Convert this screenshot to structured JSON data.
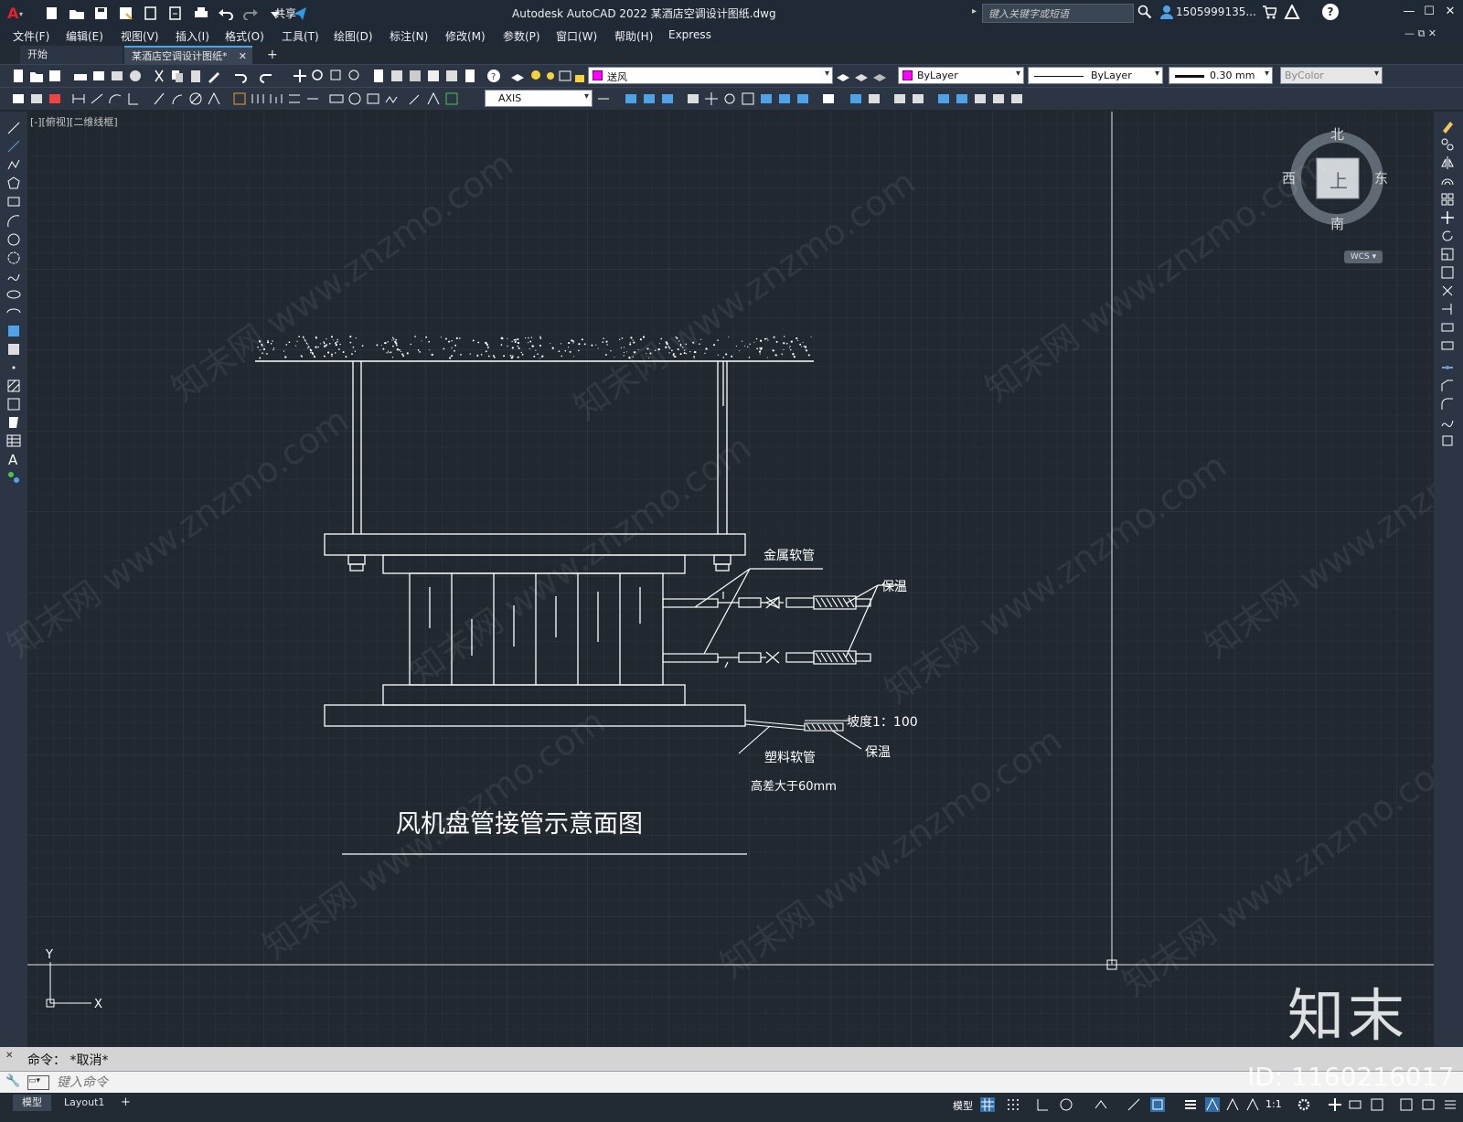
{
  "titlebar": {
    "app_title": "Autodesk AutoCAD 2022    某酒店空调设计图纸.dwg",
    "share_label": "共享",
    "search_placeholder": "键入关键字或短语",
    "user": "1505999135...",
    "help": "?"
  },
  "menu": [
    "文件(F)",
    "编辑(E)",
    "视图(V)",
    "插入(I)",
    "格式(O)",
    "工具(T)",
    "绘图(D)",
    "标注(N)",
    "修改(M)",
    "参数(P)",
    "窗口(W)",
    "帮助(H)",
    "Express"
  ],
  "tabs": {
    "start": "开始",
    "active": "某酒店空调设计图纸*",
    "new": "+"
  },
  "properties": {
    "layer": "送风",
    "color": "ByLayer",
    "linetype": "ByLayer",
    "lineweight": "0.30 mm",
    "plotstyle": "ByColor",
    "textstyle": "AXIS",
    "layer_color": "#ff00ff"
  },
  "viewport": {
    "label": "[-][俯视][二维线框]"
  },
  "viewcube": {
    "north": "北",
    "south": "南",
    "east": "东",
    "west": "西",
    "face": "上",
    "wcs": "WCS"
  },
  "drawing": {
    "title": "风机盘管接管示意面图",
    "labels": {
      "metal_hose": "金属软管",
      "insulation_top": "保温",
      "slope": "坡度1：100",
      "insulation_bottom": "保温",
      "plastic_hose": "塑料软管",
      "height_note": "高差大于60mm"
    },
    "ucs_x": "X",
    "ucs_y": "Y"
  },
  "command": {
    "history": "命令： *取消*",
    "placeholder": "键入命令"
  },
  "status": {
    "model_tab": "模型",
    "layout_tab": "Layout1",
    "add_tab": "+",
    "model_button": "模型",
    "scale": "1:1"
  },
  "watermark": {
    "brand": "知末",
    "id_text": "ID: 1160216017",
    "repeat": "知末网 www.znzmo.com"
  }
}
